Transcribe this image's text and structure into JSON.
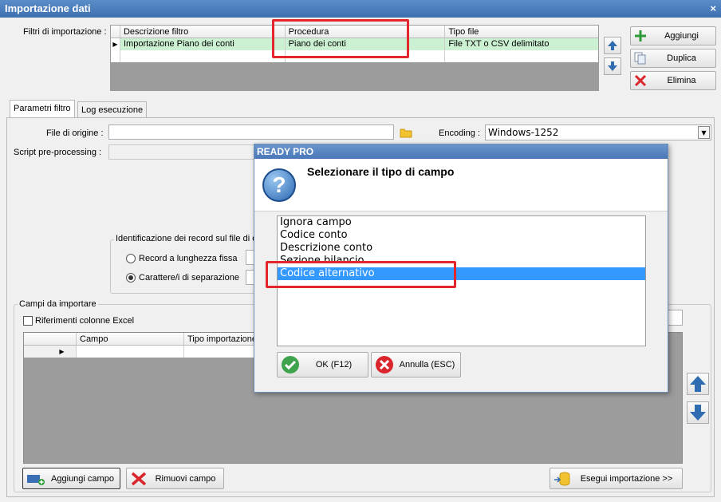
{
  "window": {
    "title": "Importazione dati",
    "close_glyph": "×"
  },
  "filters": {
    "label": "Filtri di importazione :",
    "columns": [
      "Descrizione filtro",
      "Procedura",
      "Tipo file"
    ],
    "rows": [
      {
        "marker": "▶",
        "descrizione": "Importazione Piano dei conti",
        "procedura": "Piano dei conti",
        "tipo_file": "File TXT o CSV delimitato"
      }
    ]
  },
  "actions": {
    "add": "Aggiungi",
    "duplicate": "Duplica",
    "delete": "Elimina"
  },
  "tabs": [
    "Parametri filtro",
    "Log esecuzione"
  ],
  "form": {
    "origin_label": "File di origine :",
    "origin_value": "",
    "encoding_label": "Encoding :",
    "encoding_value": "Windows-1252",
    "script_label": "Script pre-processing :",
    "record_group_label": "Identificazione dei record sul file di o",
    "radio_fixed": "Record a lunghezza fissa",
    "radio_separator": "Carattere/i di separazione"
  },
  "fields": {
    "group_label": "Campi da importare",
    "excel_refs_label": "Riferimenti colonne Excel",
    "columns": [
      "Campo",
      "Tipo importazione"
    ],
    "row_marker": "▶",
    "add_field": "Aggiungi campo",
    "remove_field": "Rimuovi campo",
    "run_import": "Esegui importazione >>"
  },
  "dialog": {
    "title": "READY PRO",
    "heading": "Selezionare il tipo di campo",
    "question_glyph": "?",
    "options": [
      "Ignora campo",
      "Codice conto",
      "Descrizione conto",
      "Sezione bilancio",
      "Codice alternativo"
    ],
    "selected_index": 4,
    "ok": "OK (F12)",
    "cancel": "Annulla (ESC)"
  },
  "colors": {
    "title_bar": "#3e6fb0",
    "grid_selected_row": "#ccf0d2",
    "highlight": "#e3262b",
    "list_selected": "#3399ff"
  }
}
